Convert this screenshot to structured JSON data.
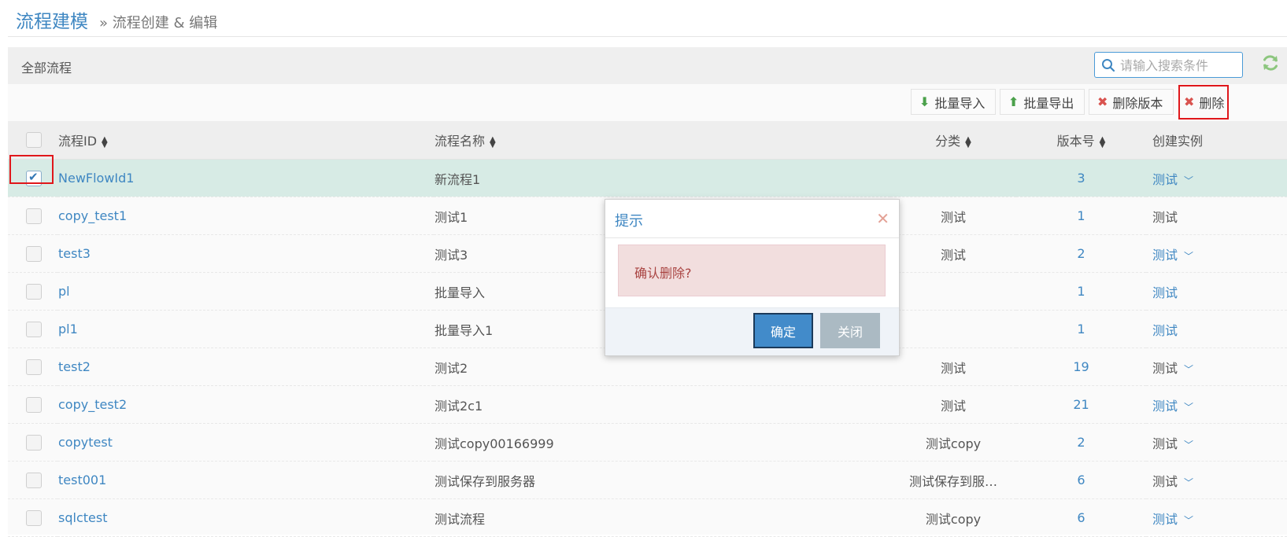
{
  "header": {
    "title": "流程建模",
    "breadcrumb": "» 流程创建 & 编辑"
  },
  "panel": {
    "title": "全部流程"
  },
  "search": {
    "placeholder": "请输入搜索条件",
    "value": ""
  },
  "toolbar": {
    "import_label": "批量导入",
    "export_label": "批量导出",
    "delete_version_label": "删除版本",
    "delete_label": "删除"
  },
  "table": {
    "columns": {
      "id": "流程ID",
      "name": "流程名称",
      "category": "分类",
      "version": "版本号",
      "create": "创建实例"
    },
    "rows": [
      {
        "id": "NewFlowId1",
        "name": "新流程1",
        "category": "",
        "version": "3",
        "action": "测试",
        "dropdown": true,
        "link": true,
        "checked": true
      },
      {
        "id": "copy_test1",
        "name": "测试1",
        "category": "测试",
        "version": "1",
        "action": "测试",
        "dropdown": false,
        "link": false,
        "checked": false
      },
      {
        "id": "test3",
        "name": "测试3",
        "category": "测试",
        "version": "2",
        "action": "测试",
        "dropdown": true,
        "link": true,
        "checked": false
      },
      {
        "id": "pl",
        "name": "批量导入",
        "category": "",
        "version": "1",
        "action": "测试",
        "dropdown": false,
        "link": true,
        "checked": false
      },
      {
        "id": "pl1",
        "name": "批量导入1",
        "category": "",
        "version": "1",
        "action": "测试",
        "dropdown": false,
        "link": true,
        "checked": false
      },
      {
        "id": "test2",
        "name": "测试2",
        "category": "测试",
        "version": "19",
        "action": "测试",
        "dropdown": true,
        "link": false,
        "checked": false
      },
      {
        "id": "copy_test2",
        "name": "测试2c1",
        "category": "测试",
        "version": "21",
        "action": "测试",
        "dropdown": true,
        "link": true,
        "checked": false
      },
      {
        "id": "copytest",
        "name": "测试copy00166999",
        "category": "测试copy",
        "version": "2",
        "action": "测试",
        "dropdown": true,
        "link": false,
        "checked": false
      },
      {
        "id": "test001",
        "name": "测试保存到服务器",
        "category": "测试保存到服…",
        "version": "6",
        "action": "测试",
        "dropdown": true,
        "link": false,
        "checked": false
      },
      {
        "id": "sqlctest",
        "name": "测试流程",
        "category": "测试copy",
        "version": "6",
        "action": "测试",
        "dropdown": true,
        "link": true,
        "checked": false
      }
    ]
  },
  "dialog": {
    "title": "提示",
    "message": "确认删除?",
    "ok_label": "确定",
    "cancel_label": "关闭"
  },
  "colors": {
    "accent": "#3f87c2",
    "selected_row": "#d7ebe5",
    "highlight": "#e0171b",
    "alert_bg": "#f2dede"
  }
}
